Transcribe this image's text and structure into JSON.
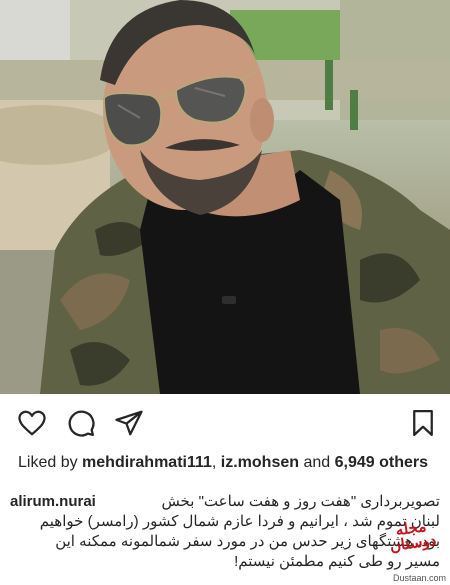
{
  "post": {
    "likes": {
      "prefix": "Liked by",
      "user1": "mehdirahmati111",
      "user2": "iz.mohsen",
      "connector": "and",
      "count_text": "6,949 others"
    },
    "caption": {
      "username": "alirum.nurai",
      "line1": "تصویربرداری \"هفت روز و هفت ساعت\" بخش",
      "line2": "لبنان تموم شد ، ایرانیم و فردا عازم شمال کشور (رامسر) خواهیم",
      "line3": "بود. هشتگهای زیر حدس من در مورد سفر شمالمونه ممکنه این",
      "line4": "مسیر رو طی کنیم مطمئن نیستم!"
    }
  },
  "icons": {
    "like": "heart-icon",
    "comment": "comment-icon",
    "share": "send-icon",
    "save": "bookmark-icon"
  },
  "watermark": {
    "logo_text": "مجله دوستان",
    "site": "Dustaan.com",
    "color": "#c4161c"
  }
}
